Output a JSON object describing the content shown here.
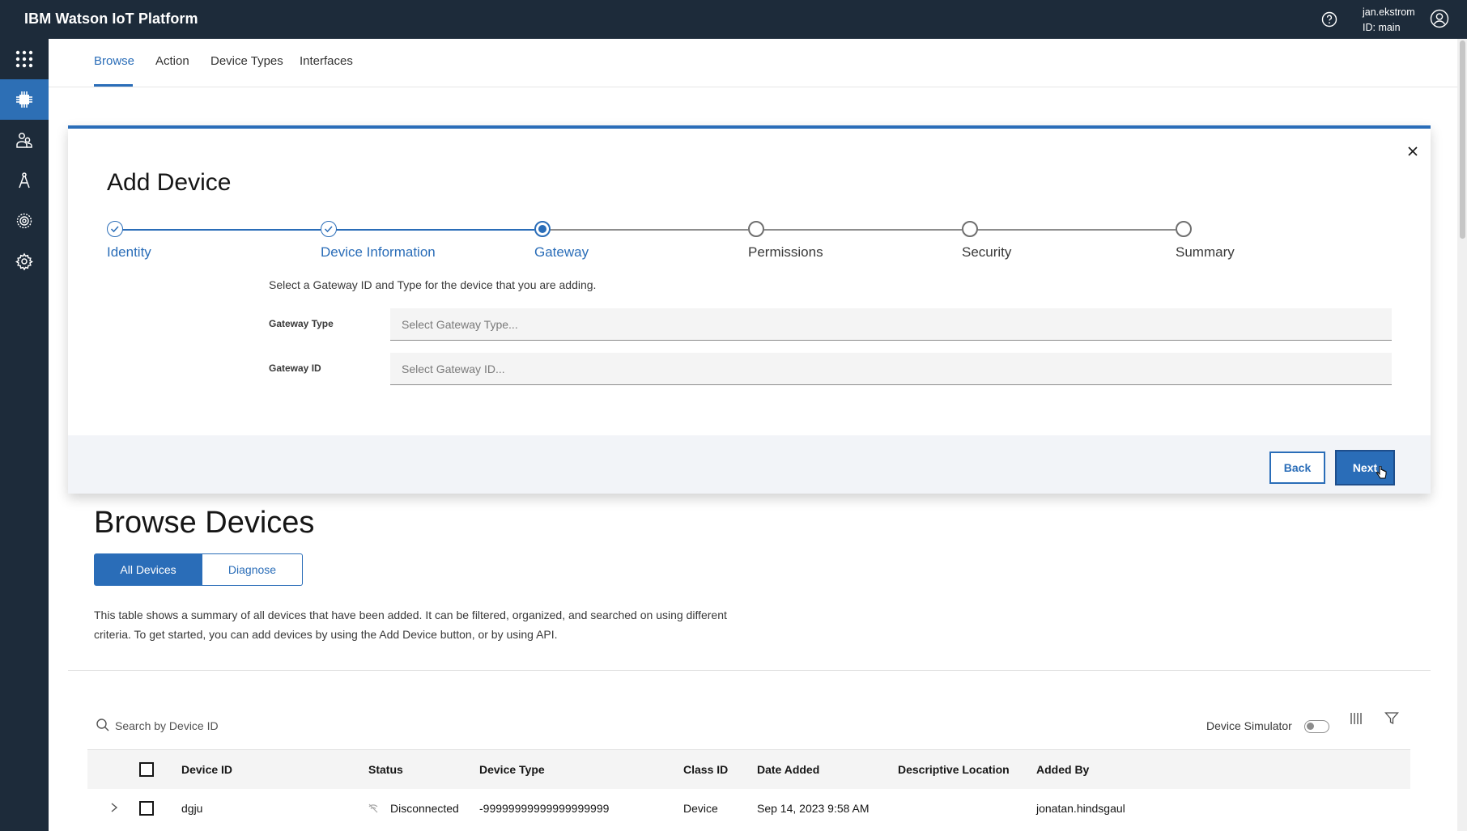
{
  "app": {
    "title": "IBM Watson IoT Platform",
    "user_name": "jan.ekstrom",
    "user_id": "ID: main"
  },
  "subnav": {
    "tabs": [
      {
        "label": "Browse",
        "active": true
      },
      {
        "label": "Action",
        "active": false
      },
      {
        "label": "Device Types",
        "active": false
      },
      {
        "label": "Interfaces",
        "active": false
      }
    ]
  },
  "sidenav": {
    "items": [
      {
        "icon": "app-grid-icon",
        "active": false
      },
      {
        "icon": "devices-chip-icon",
        "active": true
      },
      {
        "icon": "members-icon",
        "active": false
      },
      {
        "icon": "apps-compass-icon",
        "active": false
      },
      {
        "icon": "security-badge-icon",
        "active": false
      },
      {
        "icon": "settings-gear-icon",
        "active": false
      }
    ]
  },
  "modal": {
    "title": "Add Device",
    "steps": [
      {
        "label": "Identity",
        "state": "complete"
      },
      {
        "label": "Device Information",
        "state": "complete"
      },
      {
        "label": "Gateway",
        "state": "current"
      },
      {
        "label": "Permissions",
        "state": "incomplete"
      },
      {
        "label": "Security",
        "state": "incomplete"
      },
      {
        "label": "Summary",
        "state": "incomplete"
      }
    ],
    "description": "Select a Gateway ID and Type for the device that you are adding.",
    "gateway_type_label": "Gateway Type",
    "gateway_type_placeholder": "Select Gateway Type...",
    "gateway_id_label": "Gateway ID",
    "gateway_id_placeholder": "Select Gateway ID...",
    "back_label": "Back",
    "next_label": "Next"
  },
  "browse": {
    "title": "Browse Devices",
    "segments": [
      "All Devices",
      "Diagnose"
    ],
    "description": "This table shows a summary of all devices that have been added. It can be filtered, organized, and searched on using different criteria. To get started, you can add devices by using the Add Device button, or by using API.",
    "search_placeholder": "Search by Device ID",
    "simulator_label": "Device Simulator",
    "simulator_on": false
  },
  "table": {
    "columns": [
      "Device ID",
      "Status",
      "Device Type",
      "Class ID",
      "Date Added",
      "Descriptive Location",
      "Added By"
    ],
    "rows": [
      {
        "device_id": "dgju",
        "status": "Disconnected",
        "device_type": "-99999999999999999999",
        "class_id": "Device",
        "date_added": "Sep 14, 2023 9:58 AM",
        "location": "",
        "added_by": "jonatan.hindsgaul"
      }
    ]
  },
  "colors": {
    "topbar": "#1d2b3a",
    "accent": "#2a6db8",
    "active_nav": "#2d6fb5"
  }
}
